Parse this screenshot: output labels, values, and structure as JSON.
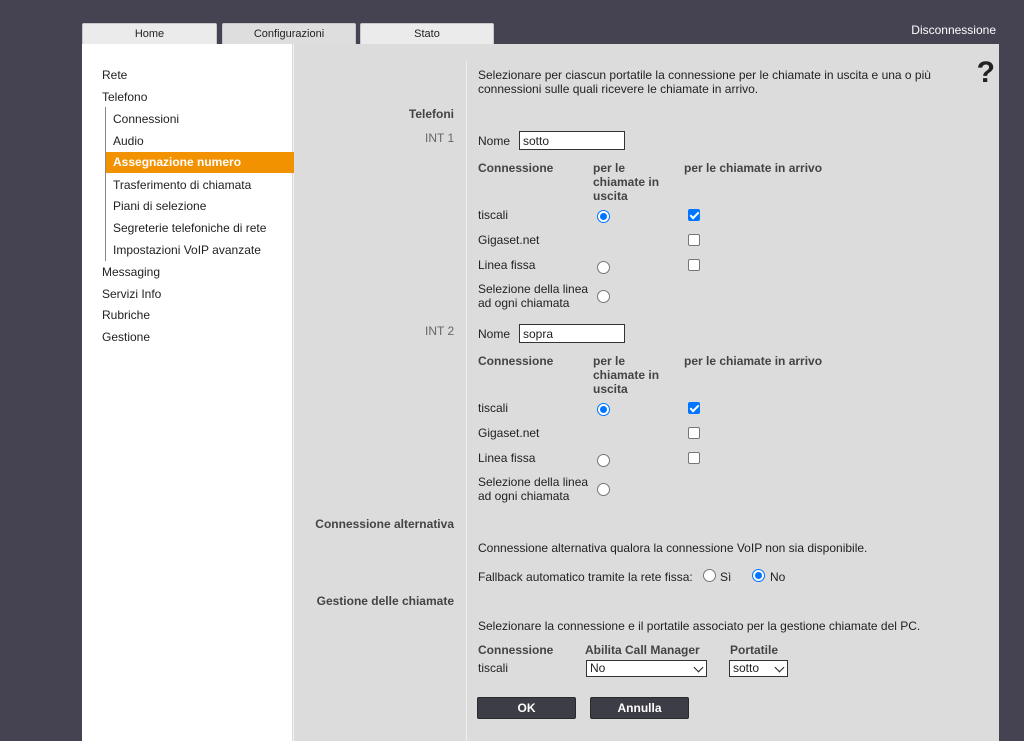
{
  "tabs": {
    "home": "Home",
    "config": "Configurazioni",
    "stato": "Stato"
  },
  "logout": "Disconnessione",
  "help": "?",
  "sidebar": {
    "rete": "Rete",
    "telefono": "Telefono",
    "connessioni": "Connessioni",
    "audio": "Audio",
    "assegnazione": "Assegnazione numero",
    "trasferimento": "Trasferimento di chiamata",
    "piani": "Piani di selezione",
    "segreterie": "Segreterie telefoniche di rete",
    "voip": "Impostazioni VoIP avanzate",
    "messaging": "Messaging",
    "servizi": "Servizi Info",
    "rubriche": "Rubriche",
    "gestione": "Gestione"
  },
  "intro": [
    "Selezionare per ciascun portatile la connessione per le chiamate in uscita e una o più",
    "connessioni sulle quali ricevere le chiamate in arrivo."
  ],
  "telefoni_title": "Telefoni",
  "nome_label": "Nome",
  "col_connessione": "Connessione",
  "col_uscita": [
    "per le",
    "chiamate in",
    "uscita"
  ],
  "col_arrivo": "per le chiamate in arrivo",
  "handsets": [
    {
      "int": "INT 1",
      "name": "sotto",
      "rows": [
        {
          "label": "tiscali",
          "out": true,
          "in": true
        },
        {
          "label": "Gigaset.net",
          "out": null,
          "in": false
        },
        {
          "label": "Linea fissa",
          "out": false,
          "in": false
        },
        {
          "label": [
            "Selezione della linea",
            "ad ogni chiamata"
          ],
          "out": false,
          "in": null
        }
      ]
    },
    {
      "int": "INT 2",
      "name": "sopra",
      "rows": [
        {
          "label": "tiscali",
          "out": true,
          "in": true
        },
        {
          "label": "Gigaset.net",
          "out": null,
          "in": false
        },
        {
          "label": "Linea fissa",
          "out": false,
          "in": false
        },
        {
          "label": [
            "Selezione della linea",
            "ad ogni chiamata"
          ],
          "out": false,
          "in": null
        }
      ]
    }
  ],
  "alt": {
    "title": "Connessione alternativa",
    "desc": "Connessione alternativa qualora la connessione VoIP non sia disponibile.",
    "fallback_label": "Fallback automatico tramite la rete fissa:",
    "si": "Sì",
    "no": "No",
    "selected": "no"
  },
  "calls": {
    "title": "Gestione delle chiamate",
    "desc": "Selezionare la connessione e il portatile associato per la gestione chiamate del PC.",
    "col_conn": "Connessione",
    "col_cm": "Abilita Call Manager",
    "col_port": "Portatile",
    "conn_value": "tiscali",
    "cm_value": "No",
    "port_value": "sotto"
  },
  "buttons": {
    "ok": "OK",
    "cancel": "Annulla"
  }
}
